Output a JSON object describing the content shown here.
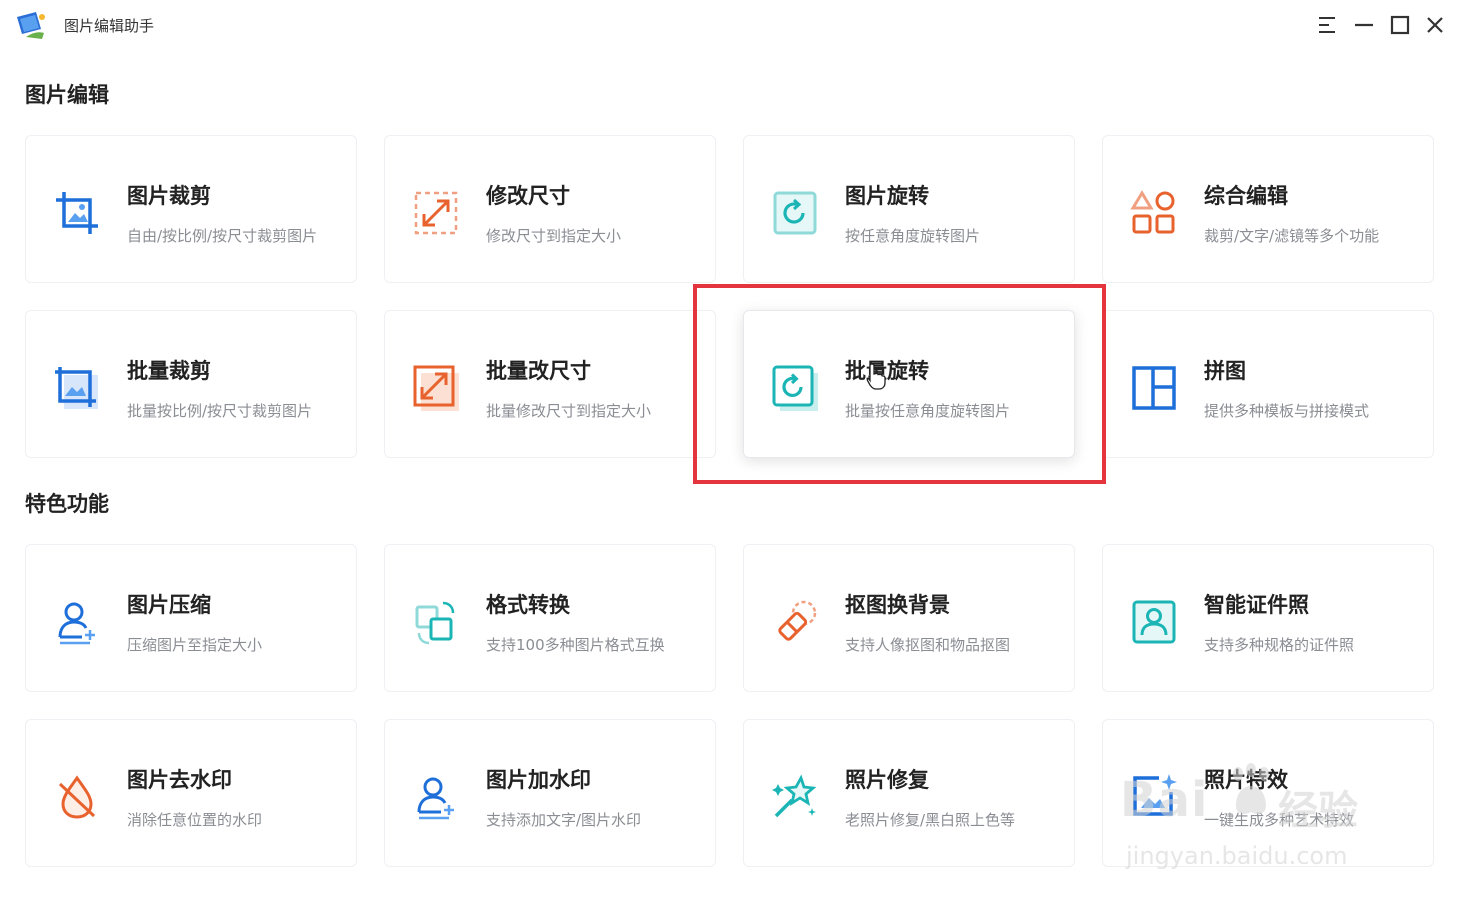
{
  "app": {
    "title": "图片编辑助手"
  },
  "window_controls": [
    "menu-icon",
    "minimize-icon",
    "maximize-icon",
    "close-icon"
  ],
  "sections": [
    {
      "title": "图片编辑",
      "cards": [
        {
          "title": "图片裁剪",
          "desc": "自由/按比例/按尺寸裁剪图片",
          "icon": "crop-icon",
          "color": "#1e6fd9"
        },
        {
          "title": "修改尺寸",
          "desc": "修改尺寸到指定大小",
          "icon": "resize-icon",
          "color": "#e8622e"
        },
        {
          "title": "图片旋转",
          "desc": "按任意角度旋转图片",
          "icon": "rotate-icon",
          "color": "#1bb5b5"
        },
        {
          "title": "综合编辑",
          "desc": "裁剪/文字/滤镜等多个功能",
          "icon": "shapes-icon",
          "color": "#e8622e"
        },
        {
          "title": "批量裁剪",
          "desc": "批量按比例/按尺寸裁剪图片",
          "icon": "batch-crop-icon",
          "color": "#1e6fd9"
        },
        {
          "title": "批量改尺寸",
          "desc": "批量修改尺寸到指定大小",
          "icon": "batch-resize-icon",
          "color": "#e8622e"
        },
        {
          "title": "批量旋转",
          "desc": "批量按任意角度旋转图片",
          "icon": "batch-rotate-icon",
          "color": "#1bb5b5"
        },
        {
          "title": "拼图",
          "desc": "提供多种模板与拼接模式",
          "icon": "collage-icon",
          "color": "#1e6fd9"
        }
      ]
    },
    {
      "title": "特色功能",
      "cards": [
        {
          "title": "图片压缩",
          "desc": "压缩图片至指定大小",
          "icon": "compress-icon",
          "color": "#1e6fd9"
        },
        {
          "title": "格式转换",
          "desc": "支持100多种图片格式互换",
          "icon": "convert-icon",
          "color": "#1bb5b5"
        },
        {
          "title": "抠图换背景",
          "desc": "支持人像抠图和物品抠图",
          "icon": "eraser-icon",
          "color": "#e8622e"
        },
        {
          "title": "智能证件照",
          "desc": "支持多种规格的证件照",
          "icon": "id-photo-icon",
          "color": "#1bb5b5"
        },
        {
          "title": "图片去水印",
          "desc": "消除任意位置的水印",
          "icon": "remove-watermark-icon",
          "color": "#e8622e"
        },
        {
          "title": "图片加水印",
          "desc": "支持添加文字/图片水印",
          "icon": "add-watermark-icon",
          "color": "#1e6fd9"
        },
        {
          "title": "照片修复",
          "desc": "老照片修复/黑白照上色等",
          "icon": "magic-wand-icon",
          "color": "#1bb5b5"
        },
        {
          "title": "照片特效",
          "desc": "一键生成多种艺术特效",
          "icon": "effects-icon",
          "color": "#1e6fd9"
        }
      ]
    }
  ],
  "watermark": {
    "brand": "Bai",
    "brand2": "经验",
    "url": "jingyan.baidu.com"
  }
}
